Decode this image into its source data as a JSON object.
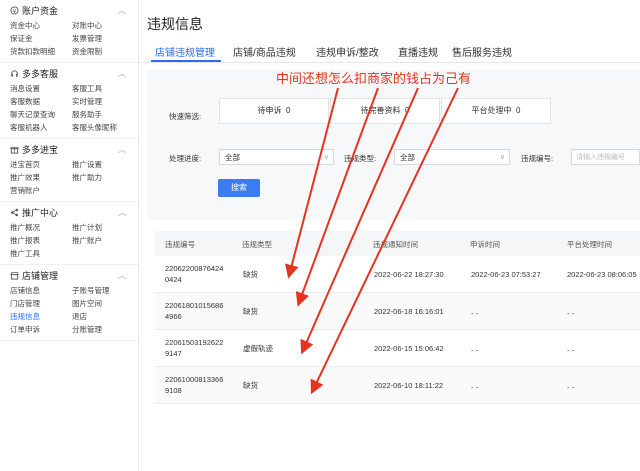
{
  "sidebar": {
    "sections": [
      {
        "title": "账户资金",
        "items": [
          "资金中心",
          "对账中心",
          "保证金",
          "发票管理",
          "货款扣款明细",
          "资金限制"
        ]
      },
      {
        "title": "多多客服",
        "items": [
          "消息设置",
          "客服工具",
          "客服数据",
          "实时管理",
          "聊天记录查询",
          "服务助手",
          "客服机器人",
          "客服头像昵称"
        ]
      },
      {
        "title": "多多进宝",
        "items": [
          "进宝首页",
          "推广设置",
          "推广效果",
          "推广助力",
          "营销账户"
        ]
      },
      {
        "title": "推广中心",
        "items": [
          "推广概况",
          "推广计划",
          "推广报表",
          "推广账户",
          "推广工具"
        ]
      },
      {
        "title": "店铺管理",
        "items": [
          "店铺信息",
          "子账号管理",
          "门店管理",
          "图片空间",
          "违规信息",
          "退店",
          "订单申诉",
          "分账管理"
        ]
      }
    ],
    "active_item": "违规信息"
  },
  "main": {
    "title": "违规信息",
    "tabs": [
      "店铺违规管理",
      "店铺/商品违规",
      "违规申诉/整改",
      "直播违规",
      "售后服务违规"
    ],
    "filter": {
      "quick_label": "快速筛选:",
      "quick": [
        {
          "label": "待申诉",
          "count": "0"
        },
        {
          "label": "待完善资料",
          "count": "0"
        },
        {
          "label": "平台处理中",
          "count": "0"
        }
      ],
      "progress_label": "处理进度:",
      "progress_value": "全部",
      "type_label": "违规类型:",
      "type_value": "全部",
      "id_label": "违规编号:",
      "id_placeholder": "请输入违规编号",
      "search_button": "搜索"
    },
    "table": {
      "headers": [
        "违规编号",
        "违规类型",
        "违规通知时间",
        "申诉时间",
        "平台处理时间"
      ],
      "rows": [
        {
          "id_line1": "22062200876424",
          "id_line2": "0424",
          "type": "缺货",
          "notice": "2022-06-22 18:27:30",
          "appeal": "2022-06-23 07:53:27",
          "process": "2022-06-23 08:06:05"
        },
        {
          "id_line1": "22061801015686",
          "id_line2": "4966",
          "type": "缺货",
          "notice": "2022-06-18 16:16:01",
          "appeal": "- -",
          "process": "- -"
        },
        {
          "id_line1": "22061503192622",
          "id_line2": "9147",
          "type": "虚假轨迹",
          "notice": "2022-06-15 15:06:42",
          "appeal": "- -",
          "process": "- -"
        },
        {
          "id_line1": "22061000813366",
          "id_line2": "9108",
          "type": "缺货",
          "notice": "2022-06-10 18:11:22",
          "appeal": "- -",
          "process": "- -"
        }
      ]
    }
  },
  "annotation": {
    "text": "中间还想怎么扣商家的钱占为己有",
    "color": "#e53320"
  },
  "colors": {
    "accent": "#2a6df4",
    "button": "#3c7cf2",
    "annotation": "#e53320"
  },
  "icons": [
    "wallet-icon",
    "headset-icon",
    "gift-icon",
    "share-icon",
    "store-icon",
    "chevron-up-icon",
    "chevron-down-icon"
  ]
}
